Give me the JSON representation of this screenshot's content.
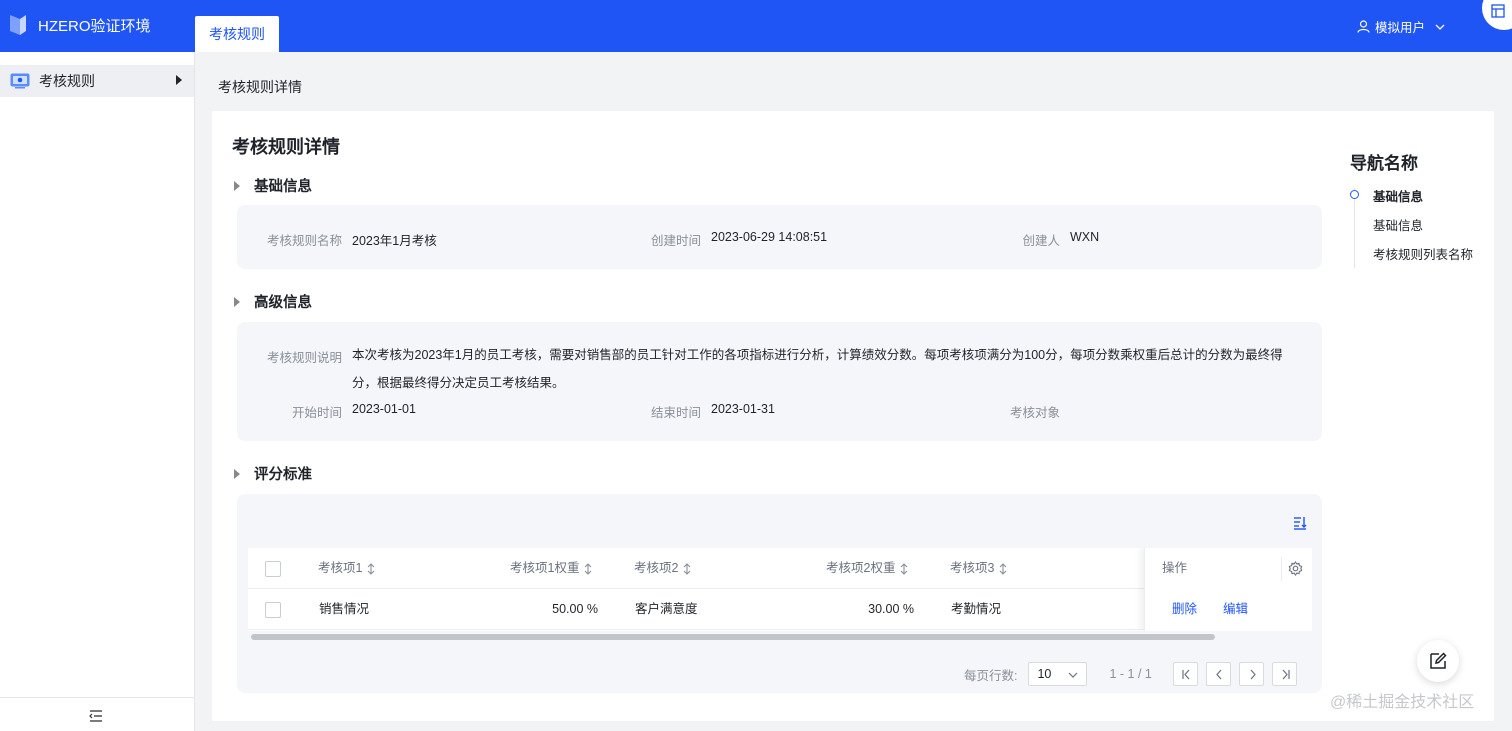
{
  "app": {
    "title": "HZERO验证环境",
    "top_tab": "考核规则",
    "user": "模拟用户"
  },
  "sidebar": {
    "items": [
      {
        "label": "考核规则"
      }
    ]
  },
  "breadcrumb": "考核规则详情",
  "page": {
    "title": "考核规则详情"
  },
  "basic": {
    "heading": "基础信息",
    "name_label": "考核规则名称",
    "name_value": "2023年1月考核",
    "created_label": "创建时间",
    "created_value": "2023-06-29 14:08:51",
    "creator_label": "创建人",
    "creator_value": "WXN"
  },
  "advanced": {
    "heading": "高级信息",
    "desc_label": "考核规则说明",
    "desc_value": "本次考核为2023年1月的员工考核，需要对销售部的员工针对工作的各项指标进行分析，计算绩效分数。每项考核项满分为100分，每项分数乘权重后总计的分数为最终得分，根据最终得分决定员工考核结果。",
    "start_label": "开始时间",
    "start_value": "2023-01-01",
    "end_label": "结束时间",
    "end_value": "2023-01-31",
    "target_label": "考核对象"
  },
  "scoring": {
    "heading": "评分标准",
    "columns": [
      "考核项1",
      "考核项1权重",
      "考核项2",
      "考核项2权重",
      "考核项3"
    ],
    "action_header": "操作",
    "rows": [
      {
        "item1": "销售情况",
        "weight1": "50.00 %",
        "item2": "客户满意度",
        "weight2": "30.00 %",
        "item3": "考勤情况",
        "delete": "删除",
        "edit": "编辑"
      }
    ],
    "pager": {
      "rows_label": "每页行数:",
      "page_size": "10",
      "info": "1 - 1 / 1"
    }
  },
  "anchor_nav": {
    "title": "导航名称",
    "items": [
      "基础信息",
      "基础信息",
      "考核规则列表名称"
    ]
  },
  "watermark": "@稀土掘金技术社区",
  "colors": {
    "primary": "#1f55f5",
    "panel": "#f5f6fa"
  }
}
